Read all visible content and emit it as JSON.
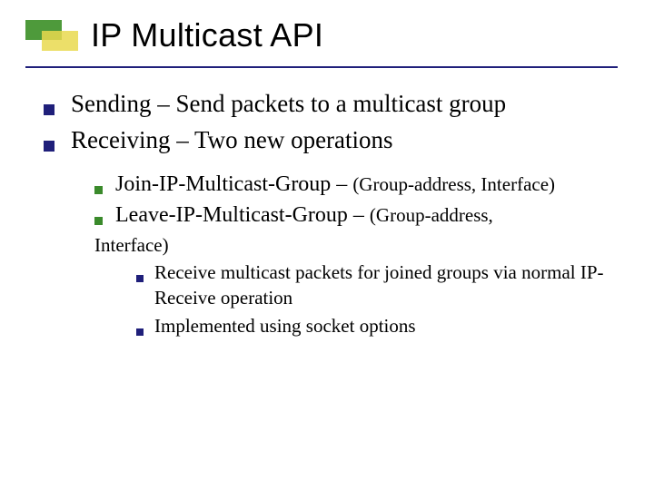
{
  "title": "IP Multicast API",
  "lvl1": [
    "Sending – Send packets to a multicast group",
    "Receiving – Two new operations"
  ],
  "lvl2": [
    {
      "main": "Join-IP-Multicast-Group – ",
      "paren": "(Group-address, Interface)"
    },
    {
      "main": "Leave-IP-Multicast-Group – ",
      "paren": "(Group-address,"
    }
  ],
  "lvl2_tail": "Interface)",
  "lvl3": [
    "Receive multicast packets for joined groups via normal IP-Receive operation",
    "Implemented using socket options"
  ]
}
